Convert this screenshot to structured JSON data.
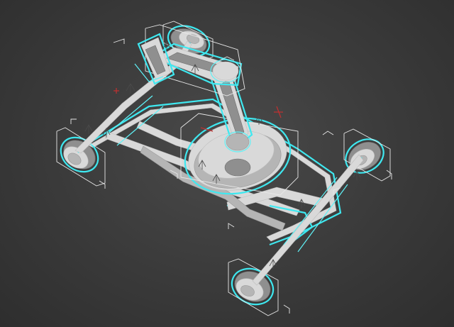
{
  "viewport": {
    "background_color": "#3a3a3a",
    "selection_color": "#3ee8f0",
    "model_color": "#d9d9d9",
    "gizmo_color": "#c23030"
  },
  "scene": {
    "objects": [
      "wheel-rear-left",
      "wheel-rear-right",
      "wheel-front-left",
      "wheel-front-right",
      "chassis-frame",
      "turntable-base",
      "arm-lower-segment",
      "arm-upper-segment",
      "gripper-head",
      "axle-front",
      "axle-rear"
    ]
  }
}
